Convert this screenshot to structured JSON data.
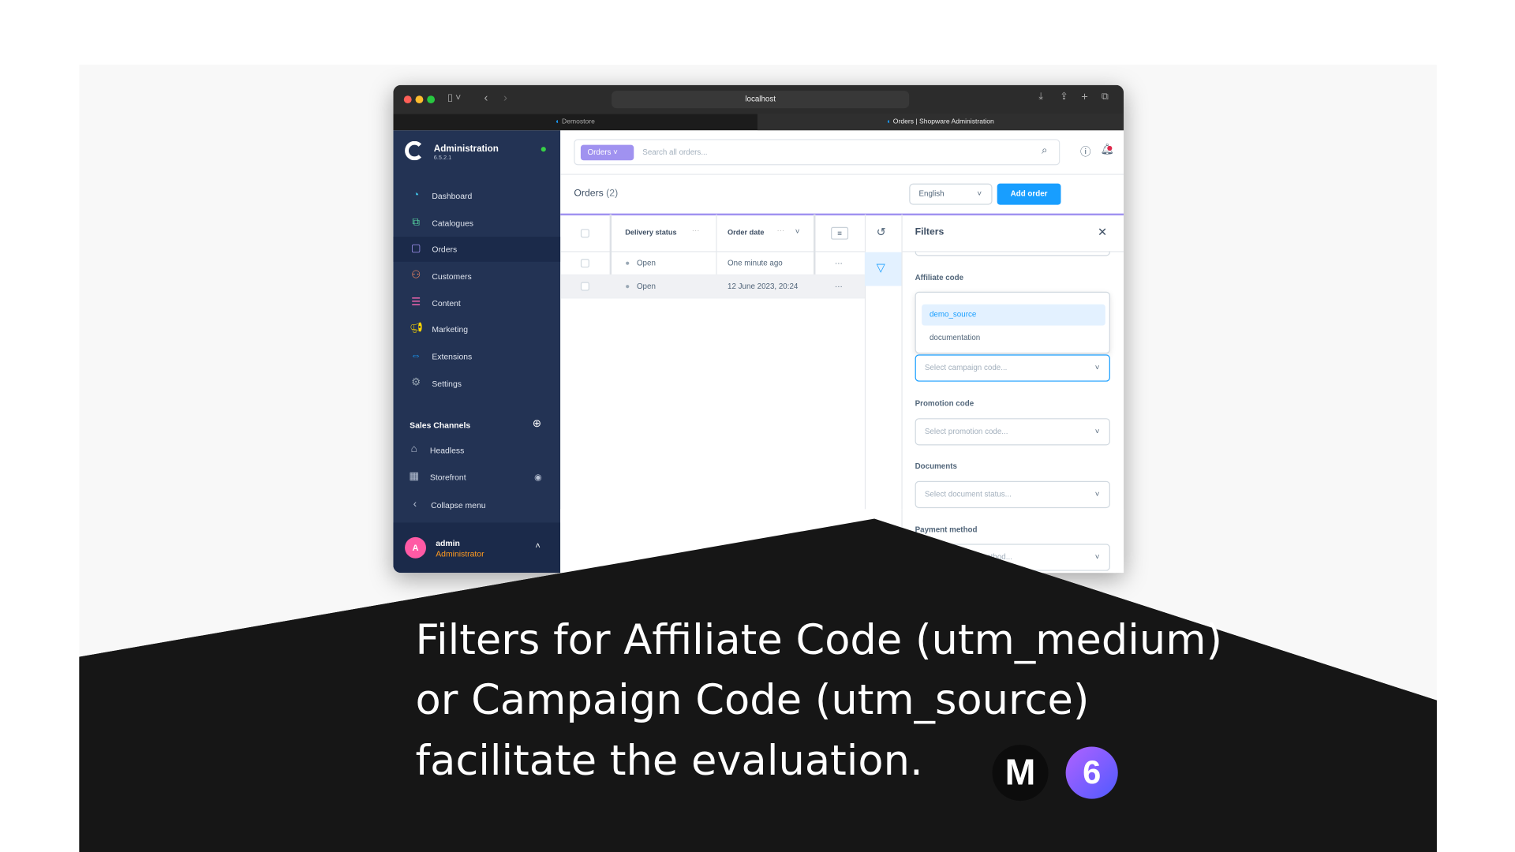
{
  "browser": {
    "url": "localhost",
    "tabs": [
      {
        "label": "Demostore"
      },
      {
        "label": "Orders | Shopware Administration"
      }
    ]
  },
  "sidebar": {
    "app_title": "Administration",
    "version": "6.5.2.1",
    "items": [
      {
        "label": "Dashboard",
        "icon": "dashboard-icon",
        "color": "#3fbde0"
      },
      {
        "label": "Catalogues",
        "icon": "catalogues-icon",
        "color": "#57d9a3"
      },
      {
        "label": "Orders",
        "icon": "orders-icon",
        "color": "#a092f0",
        "active": true
      },
      {
        "label": "Customers",
        "icon": "customers-icon",
        "color": "#f88962"
      },
      {
        "label": "Content",
        "icon": "content-icon",
        "color": "#ff68b4"
      },
      {
        "label": "Marketing",
        "icon": "marketing-icon",
        "color": "#ffd700"
      },
      {
        "label": "Extensions",
        "icon": "extensions-icon",
        "color": "#189eff"
      },
      {
        "label": "Settings",
        "icon": "settings-icon",
        "color": "#9aa8b5"
      }
    ],
    "sales_channels_title": "Sales Channels",
    "channels": [
      {
        "label": "Headless"
      },
      {
        "label": "Storefront"
      }
    ],
    "collapse_label": "Collapse menu",
    "user": {
      "initial": "A",
      "name": "admin",
      "role": "Administrator"
    }
  },
  "search": {
    "module": "Orders",
    "placeholder": "Search all orders..."
  },
  "header": {
    "title": "Orders",
    "count": "(2)",
    "language": "English",
    "add_button": "Add order"
  },
  "table": {
    "columns": [
      "Delivery status",
      "Order date"
    ],
    "rows": [
      {
        "status": "Open",
        "date": "One minute ago"
      },
      {
        "status": "Open",
        "date": "12 June 2023, 20:24"
      }
    ]
  },
  "filters": {
    "title": "Filters",
    "affiliate_label": "Affiliate code",
    "affiliate_options": [
      "demo_source",
      "documentation"
    ],
    "campaign_placeholder": "Select campaign code...",
    "promotion_label": "Promotion code",
    "promotion_placeholder": "Select promotion code...",
    "documents_label": "Documents",
    "documents_placeholder": "Select document status...",
    "payment_label": "Payment method",
    "payment_placeholder": "Select payment method..."
  },
  "caption": {
    "lines": [
      "Filters for Affiliate Code (utm_medium)",
      "or Campaign Code (utm_source)",
      "facilitate the evaluation."
    ]
  },
  "logos": {
    "m": "M",
    "six": "6"
  },
  "colors": {
    "accent": "#189eff",
    "sidebar": "#233354",
    "purple": "#a092f0"
  }
}
